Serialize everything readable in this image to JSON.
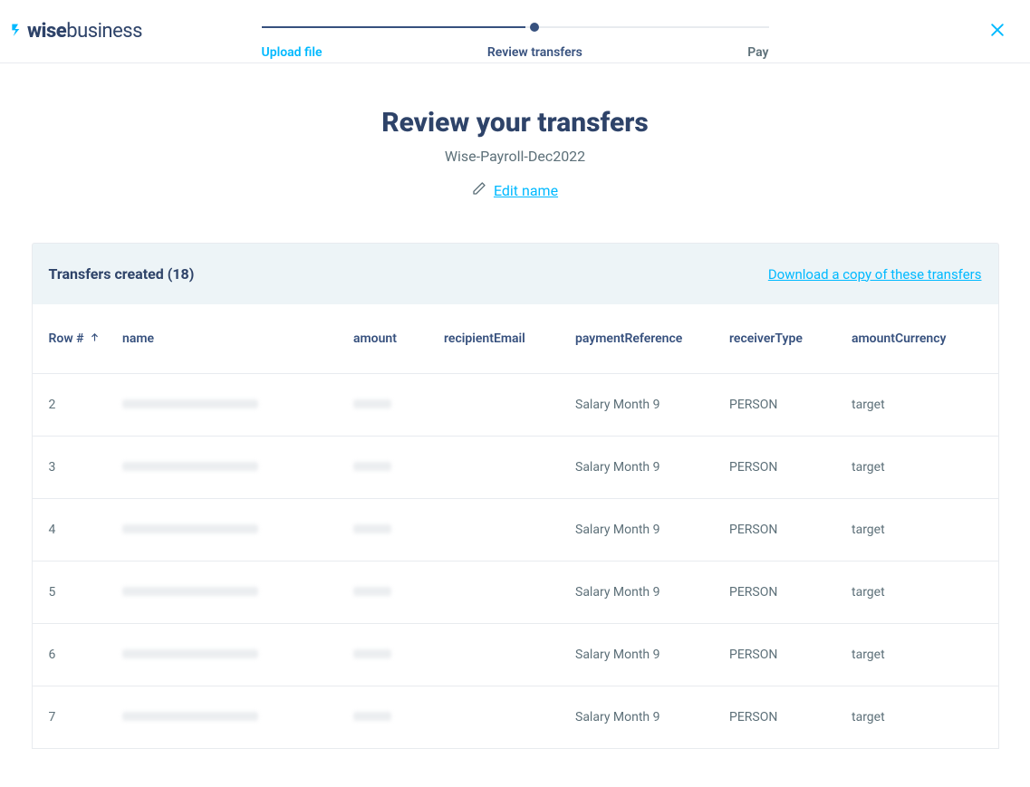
{
  "logo": {
    "word1": "wise",
    "word2": "business"
  },
  "stepper": {
    "steps": [
      {
        "label": "Upload file",
        "state": "done"
      },
      {
        "label": "Review transfers",
        "state": "current"
      },
      {
        "label": "Pay",
        "state": "upcoming"
      }
    ]
  },
  "title": "Review your transfers",
  "batch_name": "Wise-Payroll-Dec2022",
  "edit_name_label": "Edit name",
  "panel": {
    "title": "Transfers created (18)",
    "count": 18,
    "download_label": "Download a copy of these transfers"
  },
  "table": {
    "columns": {
      "row": "Row #",
      "name": "name",
      "amount": "amount",
      "recipientEmail": "recipientEmail",
      "paymentReference": "paymentReference",
      "receiverType": "receiverType",
      "amountCurrency": "amountCurrency"
    },
    "sort": {
      "column": "row",
      "direction": "asc"
    },
    "rows": [
      {
        "row": "2",
        "name": "",
        "amount": "",
        "recipientEmail": "",
        "paymentReference": "Salary Month 9",
        "receiverType": "PERSON",
        "amountCurrency": "target"
      },
      {
        "row": "3",
        "name": "",
        "amount": "",
        "recipientEmail": "",
        "paymentReference": "Salary Month 9",
        "receiverType": "PERSON",
        "amountCurrency": "target"
      },
      {
        "row": "4",
        "name": "",
        "amount": "",
        "recipientEmail": "",
        "paymentReference": "Salary Month 9",
        "receiverType": "PERSON",
        "amountCurrency": "target"
      },
      {
        "row": "5",
        "name": "",
        "amount": "",
        "recipientEmail": "",
        "paymentReference": "Salary Month 9",
        "receiverType": "PERSON",
        "amountCurrency": "target"
      },
      {
        "row": "6",
        "name": "",
        "amount": "",
        "recipientEmail": "",
        "paymentReference": "Salary Month 9",
        "receiverType": "PERSON",
        "amountCurrency": "target"
      },
      {
        "row": "7",
        "name": "",
        "amount": "",
        "recipientEmail": "",
        "paymentReference": "Salary Month 9",
        "receiverType": "PERSON",
        "amountCurrency": "target"
      }
    ]
  }
}
